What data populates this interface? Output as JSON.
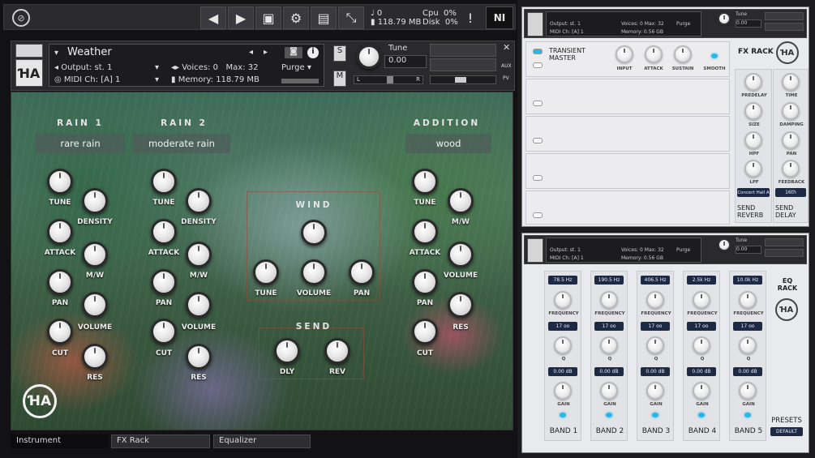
{
  "toolbar": {
    "prev_icon": "chevron-left-icon",
    "next_icon": "chevron-right-icon",
    "voices_value": "0",
    "memory_value": "118.79 MB",
    "cpu_label": "Cpu",
    "cpu_value": "0%",
    "disk_label": "Disk",
    "disk_value": "0%",
    "alert_label": "!",
    "ni_label": "NI"
  },
  "instrument": {
    "name": "Weather",
    "output_label": "Output:",
    "output_value": "st. 1",
    "voices_label": "Voices:",
    "voices_value": "0",
    "max_label": "Max:",
    "max_value": "32",
    "purge_label": "Purge",
    "midi_label": "MIDI Ch:",
    "midi_value": "[A]  1",
    "memory_label": "Memory:",
    "memory_value": "118.79 MB",
    "solo_label": "S",
    "mute_label": "M",
    "tune_label": "Tune",
    "tune_value": "0.00",
    "pan_left": "L",
    "pan_right": "R",
    "aux_label": "AUX",
    "pv_label": "PV"
  },
  "rain1": {
    "title": "RAIN 1",
    "selection": "rare rain",
    "knobs": {
      "tune": "TUNE",
      "density": "DENSITY",
      "attack": "ATTACK",
      "mw": "M/W",
      "pan": "PAN",
      "volume": "VOLUME",
      "cut": "CUT",
      "res": "RES"
    }
  },
  "rain2": {
    "title": "RAIN 2",
    "selection": "moderate rain",
    "knobs": {
      "tune": "TUNE",
      "density": "DENSITY",
      "attack": "ATTACK",
      "mw": "M/W",
      "pan": "PAN",
      "volume": "VOLUME",
      "cut": "CUT",
      "res": "RES"
    }
  },
  "wind": {
    "title": "WIND",
    "knobs": {
      "tune": "TUNE",
      "volume": "VOLUME",
      "pan": "PAN"
    }
  },
  "send": {
    "title": "SEND",
    "knobs": {
      "dly": "DLY",
      "rev": "REV"
    }
  },
  "addition": {
    "title": "ADDITION",
    "selection": "wood",
    "knobs": {
      "tune": "TUNE",
      "mw": "M/W",
      "attack": "ATTACK",
      "volume": "VOLUME",
      "pan": "PAN",
      "res": "RES",
      "cut": "CUT"
    }
  },
  "tabs": [
    "Instrument",
    "FX Rack",
    "Equalizer"
  ],
  "fx_panel": {
    "mini": {
      "output": "st. 1",
      "voices": "0",
      "max": "32",
      "midi": "[A] 1",
      "memory": "0.56 GB",
      "purge": "Purge",
      "tune_label": "Tune",
      "tune_value": "0.00"
    },
    "transient_title": "TRANSIENT MASTER",
    "transient_knobs": [
      "INPUT",
      "ATTACK",
      "SUSTAIN"
    ],
    "smooth_label": "SMOOTH",
    "rack_title": "FX RACK",
    "reverb_knobs": [
      "PREDELAY",
      "SIZE",
      "HPF",
      "LPF"
    ],
    "delay_knobs": [
      "TIME",
      "DAMPING",
      "PAN",
      "FEEDBACK"
    ],
    "reverb_preset": "Concert Hall A",
    "delay_preset": "16th",
    "send_reverb": "SEND REVERB",
    "send_delay": "SEND DELAY"
  },
  "eq_panel": {
    "mini": {
      "output": "st. 1",
      "voices": "0",
      "max": "32",
      "midi": "[A] 1",
      "memory": "0.56 GB",
      "purge": "Purge",
      "tune_label": "Tune",
      "tune_value": "0.00"
    },
    "title": "EQ RACK",
    "bands": [
      {
        "label": "BAND 1",
        "freq": "78.5 Hz",
        "q": "17 oo",
        "gain": "0.00 dB"
      },
      {
        "label": "BAND 2",
        "freq": "190.5 Hz",
        "q": "17 oo",
        "gain": "0.00 dB"
      },
      {
        "label": "BAND 3",
        "freq": "406.5 Hz",
        "q": "17 oo",
        "gain": "0.00 dB"
      },
      {
        "label": "BAND 4",
        "freq": "2.5k Hz",
        "q": "17 oo",
        "gain": "0.00 dB"
      },
      {
        "label": "BAND 5",
        "freq": "10.0k Hz",
        "q": "17 oo",
        "gain": "0.00 dB"
      }
    ],
    "knob_labels": {
      "frequency": "FREQUENCY",
      "q": "Q",
      "gain": "GAIN"
    },
    "presets_label": "PRESETS",
    "presets_value": "DEFAULT"
  }
}
